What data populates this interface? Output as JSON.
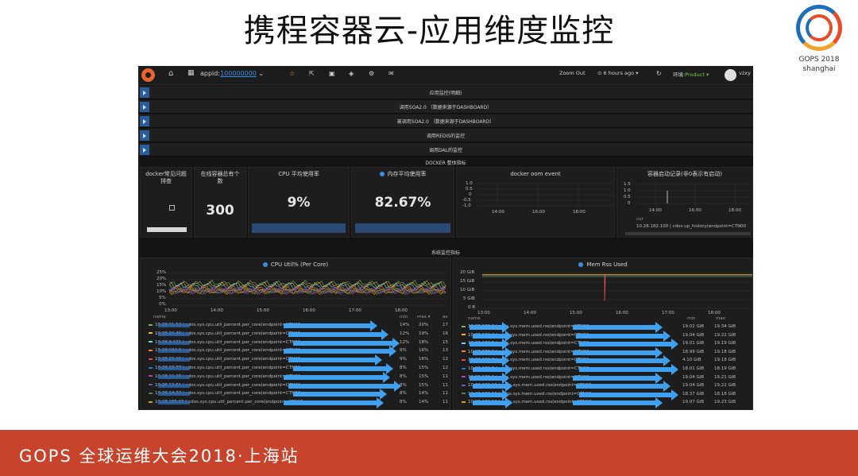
{
  "slide": {
    "title": "携程容器云-应用维度监控",
    "logo": {
      "name": "GOPS",
      "year": "2018",
      "city": "shanghai"
    },
    "footer": "GOPS 全球运维大会2018·上海站"
  },
  "navbar": {
    "appid_label": "appid:",
    "appid_value": "100000000",
    "zoom_out": "Zoom Out",
    "time_range": "⊙ 6 hours ago ▾",
    "env_label": "环境:",
    "env_value": "Product ▾",
    "user": "vzxy",
    "icons": [
      "home-icon",
      "dashboard-grid-icon",
      "star-icon",
      "share-icon",
      "save-icon",
      "settings-icon",
      "refresh-icon"
    ]
  },
  "collapsed_rows": [
    {
      "title": "应用监控(明细)"
    },
    {
      "title": "调用SOA2.0 （数据来源于DASHBOARD）"
    },
    {
      "title": "被调用SOA2.0 （数据来源于DASHBOARD）"
    },
    {
      "title": "调用REDIS的监控"
    },
    {
      "title": "调用DAL的监控"
    }
  ],
  "docker_section": {
    "title": "DOCKER 整体指标",
    "panels": {
      "docker_issue": {
        "title": "docker常见问题排查"
      },
      "online_count": {
        "title": "在线容器总有个数",
        "value": "300"
      },
      "cpu_avg": {
        "title": "CPU 平均使用率",
        "value": "9%"
      },
      "mem_avg": {
        "title": "内存平均使用率",
        "value": "82.67%"
      },
      "oom": {
        "title": "docker oom event",
        "y_ticks": [
          "1.0",
          "0.5",
          "0",
          "-0.5",
          "-1.0"
        ],
        "x_ticks": [
          "14:00",
          "16:00",
          "18:00"
        ]
      },
      "restart": {
        "title": "容器启动记录(非0表示有启动)",
        "y_ticks": [
          "1.5",
          "1.0",
          "0.5",
          "0"
        ],
        "x_ticks": [
          "14:00",
          "16:00",
          "18:00"
        ],
        "legend_head": "cur",
        "legend_row": "10.28.182.100 | cdos.up_history(endpoint=CTN00"
      }
    }
  },
  "system_section": {
    "title": "系统监控指标",
    "cpu_chart": {
      "title": "CPU Util% (Per Core)",
      "y_ticks": [
        "25%",
        "20%",
        "15%",
        "10%",
        "5%",
        "0%"
      ],
      "x_ticks": [
        "13:00",
        "14:00",
        "15:00",
        "16:00",
        "17:00",
        "18:00"
      ],
      "legend_columns": [
        "name",
        "min",
        "max ▾",
        "av"
      ],
      "legend_rows": [
        {
          "name": "10.28.11.52 | cdos.sys.cpu.util_percent.per_core(endpoint=CTN00…",
          "min": "14%",
          "max": "20%",
          "avg": "17",
          "color": "#7eb26d"
        },
        {
          "name": "10.28.10.48 | cdos.sys.cpu.util_percent.per_core(endpoint=CTN00…",
          "min": "12%",
          "max": "19%",
          "avg": "16",
          "color": "#eab839"
        },
        {
          "name": "10.28.9.121 | cdos.sys.cpu.util_percent.per_core(endpoint=CTN00…",
          "min": "12%",
          "max": "18%",
          "avg": "15",
          "color": "#6ed0e0"
        },
        {
          "name": "10.28.184.8 | cdos.sys.cpu.util_percent.per_core(endpoint=CTN00…",
          "min": "9%",
          "max": "16%",
          "avg": "13",
          "color": "#ef843c"
        },
        {
          "name": "10.28.15.16 | cdos.sys.cpu.util_percent.per_core(endpoint=CTN00…",
          "min": "9%",
          "max": "16%",
          "avg": "12",
          "color": "#e24d42"
        },
        {
          "name": "10.28.10.77 | cdos.sys.cpu.util_percent.per_core(endpoint=CTN00…",
          "min": "8%",
          "max": "15%",
          "avg": "12",
          "color": "#1f78c1"
        },
        {
          "name": "10.28.11.26 | cdos.sys.cpu.util_percent.per_core(endpoint=CTN00…",
          "min": "8%",
          "max": "15%",
          "avg": "11",
          "color": "#ba43a9"
        },
        {
          "name": "10.28.12.61 | cdos.sys.cpu.util_percent.per_core(endpoint=CTN00…",
          "min": "8%",
          "max": "15%",
          "avg": "11",
          "color": "#705da0"
        },
        {
          "name": "10.28.14.33 | cdos.sys.cpu.util_percent.per_core(endpoint=CTN00…",
          "min": "8%",
          "max": "14%",
          "avg": "11",
          "color": "#508642"
        },
        {
          "name": "10.28.185.62 | cdos.sys.cpu.util_percent.per_core(endpoint=CTN00…",
          "min": "8%",
          "max": "14%",
          "avg": "11",
          "color": "#cca300"
        }
      ]
    },
    "mem_chart": {
      "title": "Mem Rss Used",
      "y_ticks": [
        "20 GiB",
        "15 GiB",
        "10 GiB",
        "5 GiB",
        "0 B"
      ],
      "x_ticks": [
        "13:00",
        "14:00",
        "15:00",
        "16:00",
        "17:00",
        "18:00"
      ],
      "legend_columns": [
        "name",
        "min",
        "max"
      ],
      "legend_rows": [
        {
          "name": "10.28.182.3 | cdos.sys.mem.used.rss(endpoint=CTN00…",
          "min": "19.02 GiB",
          "max": "19.34 GiB",
          "color": "#7eb26d"
        },
        {
          "name": "10.28.182.4 | cdos.sys.mem.used.rss(endpoint=CTN00…",
          "min": "19.04 GiB",
          "max": "19.22 GiB",
          "color": "#eab839"
        },
        {
          "name": "10.28.182.5 | cdos.sys.mem.used.rss(endpoint=CTN00…",
          "min": "19.01 GiB",
          "max": "19.19 GiB",
          "color": "#6ed0e0"
        },
        {
          "name": "10.28.182.6 | cdos.sys.mem.used.rss(endpoint=CTN00…",
          "min": "18.99 GiB",
          "max": "19.18 GiB",
          "color": "#ef843c"
        },
        {
          "name": "10.28.182.7 | cdos.sys.mem.used.rss(endpoint=CTN00…",
          "min": "4.10 GiB",
          "max": "19.18 GiB",
          "color": "#e24d42"
        },
        {
          "name": "10.28.182.8 | cdos.sys.mem.used.rss(endpoint=CTN00…",
          "min": "18.01 GiB",
          "max": "18.19 GiB",
          "color": "#1f78c1"
        },
        {
          "name": "10.28.182.9 | cdos.sys.mem.used.rss(endpoint=CTN00…",
          "min": "19.04 GiB",
          "max": "19.21 GiB",
          "color": "#ba43a9"
        },
        {
          "name": "10.28.182.10 | cdos.sys.mem.used.rss(endpoint=CTN00…",
          "min": "19.04 GiB",
          "max": "19.22 GiB",
          "color": "#705da0"
        },
        {
          "name": "10.28.182.11 | cdos.sys.mem.used.rss(endpoint=CTN00…",
          "min": "18.37 GiB",
          "max": "18.18 GiB",
          "color": "#508642"
        },
        {
          "name": "10.28.182.12 | cdos.sys.mem.used.rss(endpoint=CTN00…",
          "min": "19.07 GiB",
          "max": "19.23 GiB",
          "color": "#cca300"
        }
      ]
    }
  },
  "colors": {
    "dash_bg": "#141414",
    "panel_bg": "#1d1d1d",
    "accent_blue": "#3b8fe0",
    "footer_red": "#c8432c"
  }
}
